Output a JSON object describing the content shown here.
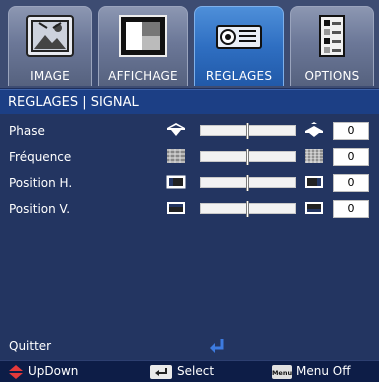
{
  "tabs": [
    {
      "label": "IMAGE",
      "icon": "picture-icon",
      "active": false
    },
    {
      "label": "AFFICHAGE",
      "icon": "display-icon",
      "active": false
    },
    {
      "label": "REGLAGES",
      "icon": "projector-icon",
      "active": true
    },
    {
      "label": "OPTIONS",
      "icon": "options-icon",
      "active": false
    }
  ],
  "section_title": "REGLAGES | SIGNAL",
  "rows": [
    {
      "label": "Phase",
      "value": "0",
      "level": 0.5,
      "icon_left": "phase-decrease-icon",
      "icon_right": "phase-increase-icon"
    },
    {
      "label": "Fréquence",
      "value": "0",
      "level": 0.5,
      "icon_left": "frequency-decrease-icon",
      "icon_right": "frequency-increase-icon"
    },
    {
      "label": "Position H.",
      "value": "0",
      "level": 0.5,
      "icon_left": "h-position-left-icon",
      "icon_right": "h-position-right-icon"
    },
    {
      "label": "Position V.",
      "value": "0",
      "level": 0.5,
      "icon_left": "v-position-down-icon",
      "icon_right": "v-position-up-icon"
    }
  ],
  "quit": {
    "label": "Quitter",
    "icon": "enter-icon"
  },
  "footer": {
    "updown": "UpDown",
    "select": "Select",
    "menu_badge": "Menu",
    "menu_off": "Menu Off"
  },
  "colors": {
    "active_tab": "#2f6fc2",
    "background": "#233561",
    "title_bar": "#1c3f85",
    "footer": "#0d1d47",
    "updown_arrow": "#e5393a"
  }
}
